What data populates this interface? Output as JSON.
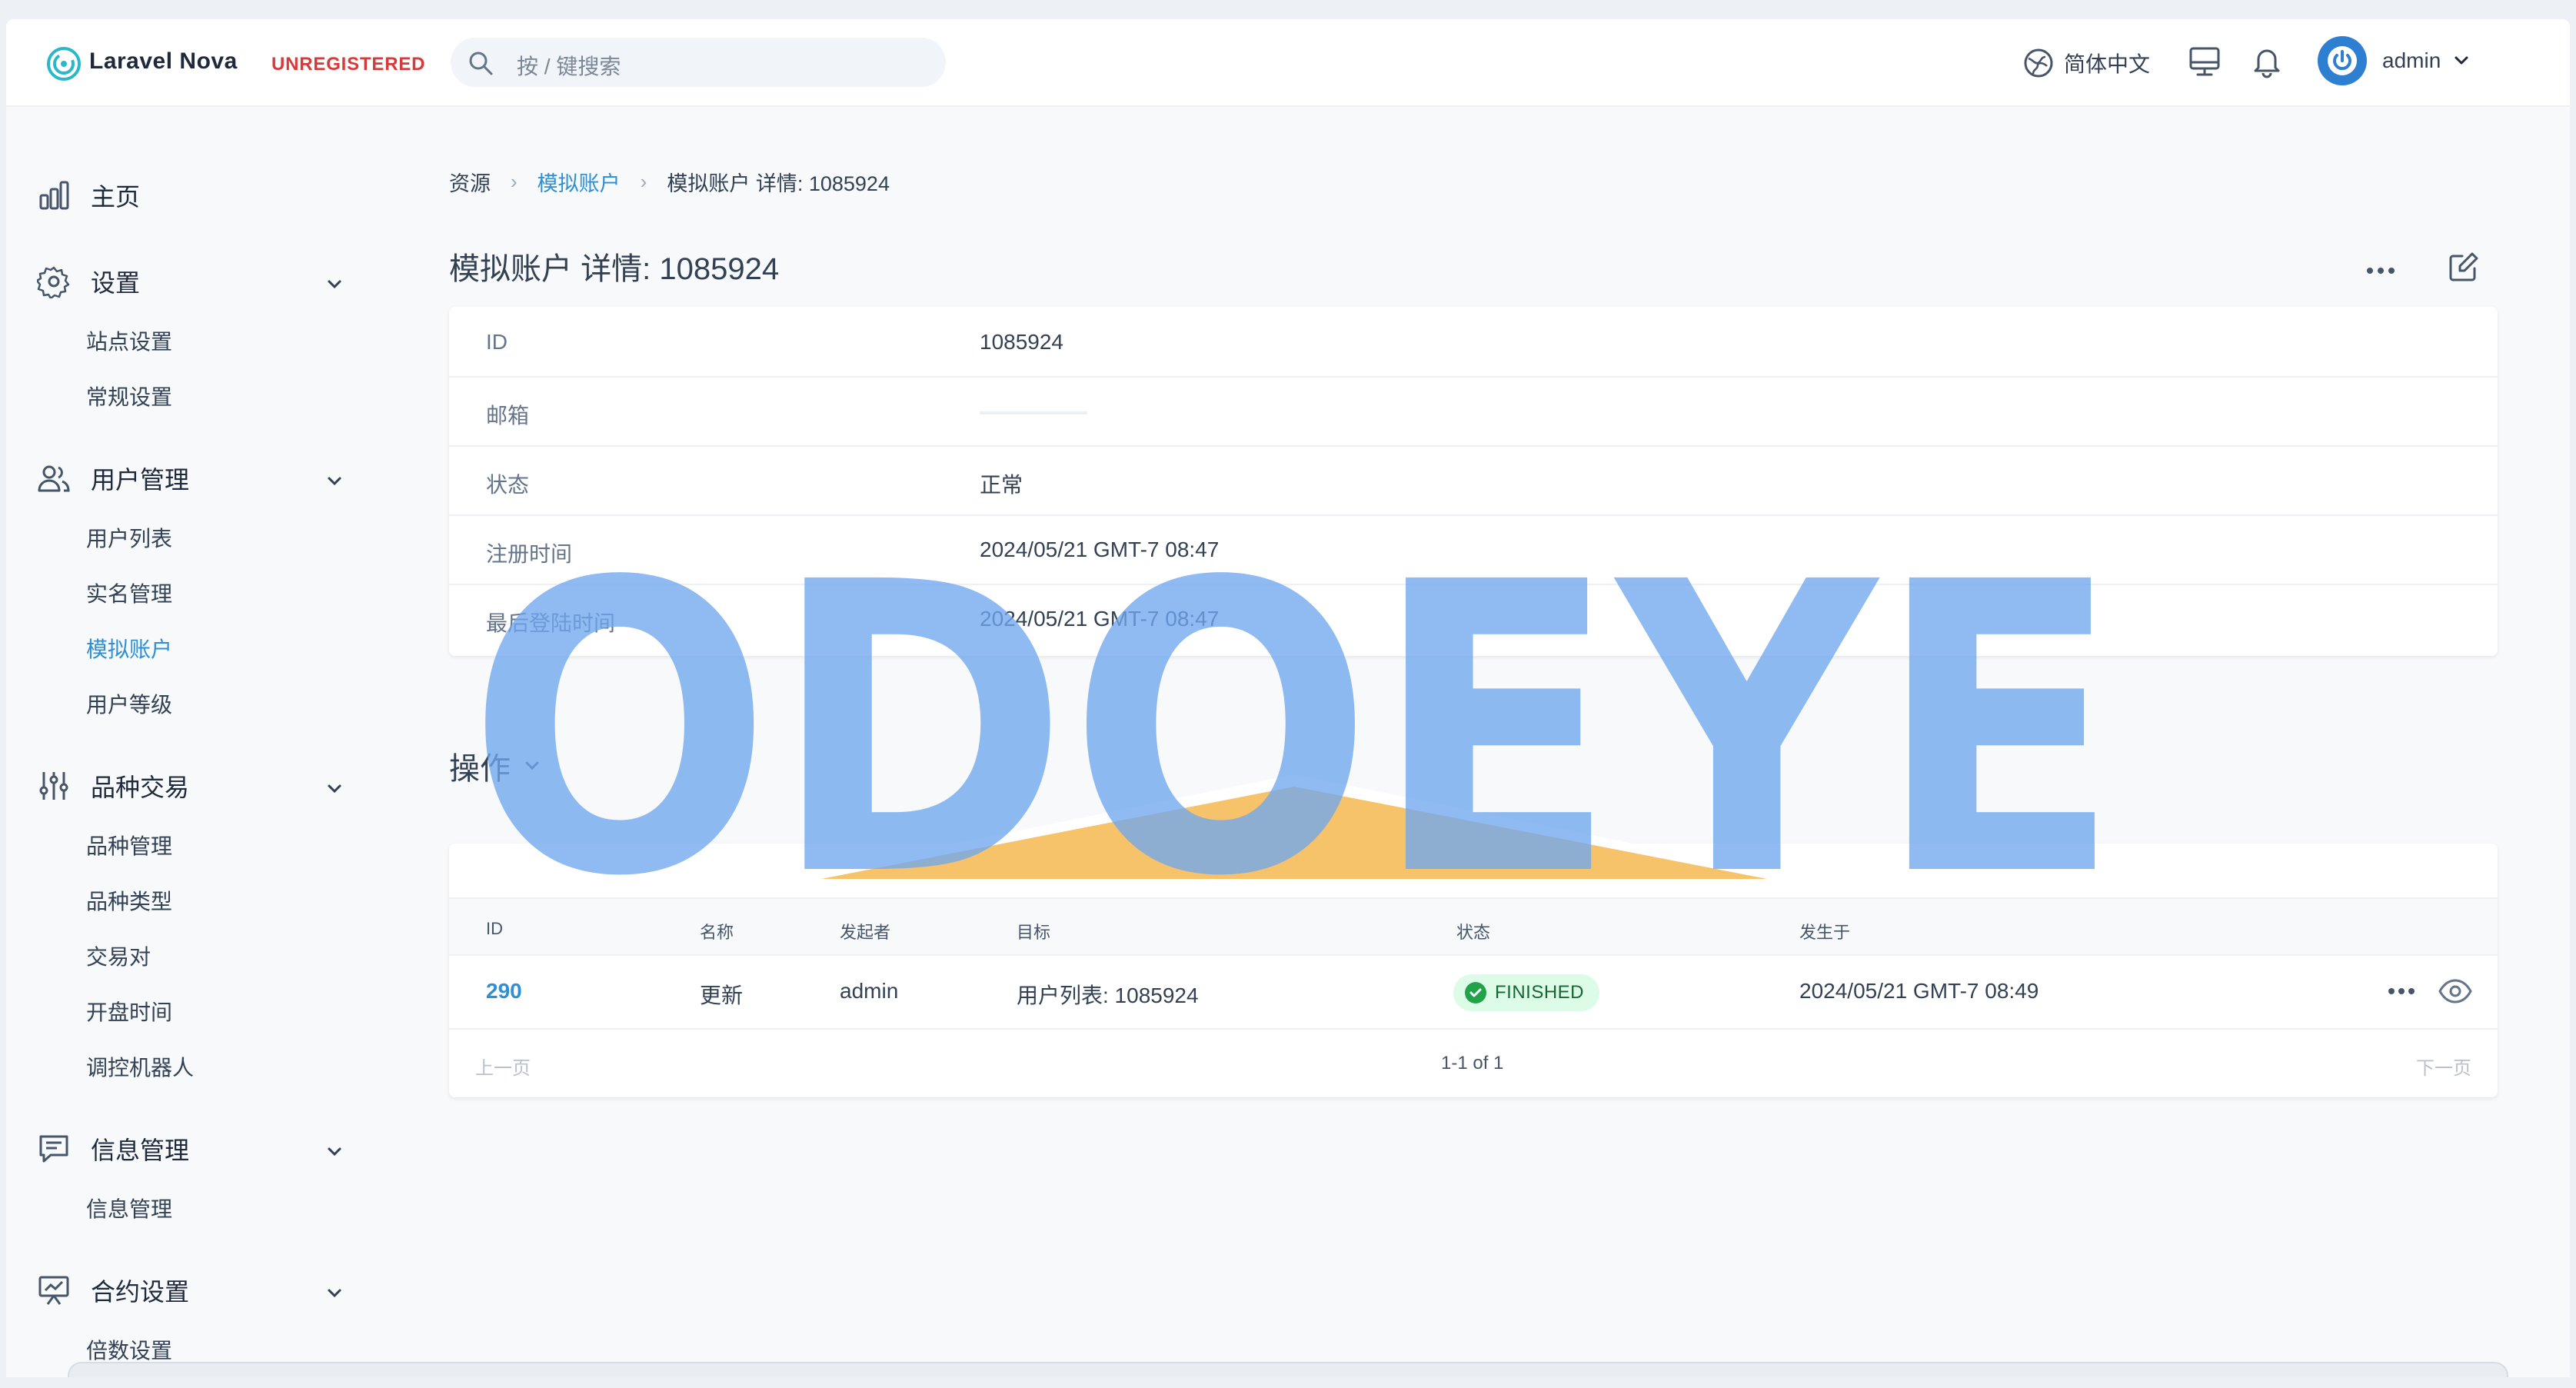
{
  "header": {
    "brand": "Laravel Nova",
    "license_badge": "UNREGISTERED",
    "search_placeholder": "按 / 键搜索",
    "language": "简体中文",
    "user_name": "admin",
    "icons": [
      "nova-logo-icon",
      "search-icon",
      "globe-icon",
      "monitor-icon",
      "bell-icon",
      "power-avatar-icon",
      "chevron-down-icon"
    ]
  },
  "sidebar": {
    "home": "主页",
    "sections": [
      {
        "label": "设置",
        "icon": "gear-icon",
        "items": [
          "站点设置",
          "常规设置"
        ]
      },
      {
        "label": "用户管理",
        "icon": "users-icon",
        "items": [
          "用户列表",
          "实名管理",
          "模拟账户",
          "用户等级"
        ]
      },
      {
        "label": "品种交易",
        "icon": "sliders-icon",
        "items": [
          "品种管理",
          "品种类型",
          "交易对",
          "开盘时间",
          "调控机器人"
        ]
      },
      {
        "label": "信息管理",
        "icon": "message-icon",
        "items": [
          "信息管理"
        ]
      },
      {
        "label": "合约设置",
        "icon": "presentation-icon",
        "items": [
          "倍数设置"
        ]
      }
    ],
    "active_item": "模拟账户",
    "accent": "#2d8fd6"
  },
  "breadcrumb": [
    "资源",
    "模拟账户",
    "模拟账户 详情: 1085924"
  ],
  "page_title": "模拟账户 详情: 1085924",
  "details": [
    {
      "label": "ID",
      "value": "1085924"
    },
    {
      "label": "邮箱",
      "value": ""
    },
    {
      "label": "状态",
      "value": "正常"
    },
    {
      "label": "注册时间",
      "value": "2024/05/21 GMT-7 08:47"
    },
    {
      "label": "最后登陆时间",
      "value": "2024/05/21 GMT-7 08:47"
    }
  ],
  "actions_section": {
    "title": "操作",
    "columns": [
      "ID",
      "名称",
      "发起者",
      "目标",
      "状态",
      "发生于"
    ],
    "rows": [
      {
        "id": "290",
        "name": "更新",
        "initiator": "admin",
        "target": "用户列表: 1085924",
        "status": "FINISHED",
        "occurred_at": "2024/05/21 GMT-7 08:49"
      }
    ],
    "pagination": {
      "prev": "上一页",
      "count": "1-1 of 1",
      "next": "下一页"
    },
    "status_color": "#22a34a"
  },
  "watermark": {
    "text": "ODOEYE",
    "color": "#6fa6ee",
    "accent": "#f6c36b"
  }
}
